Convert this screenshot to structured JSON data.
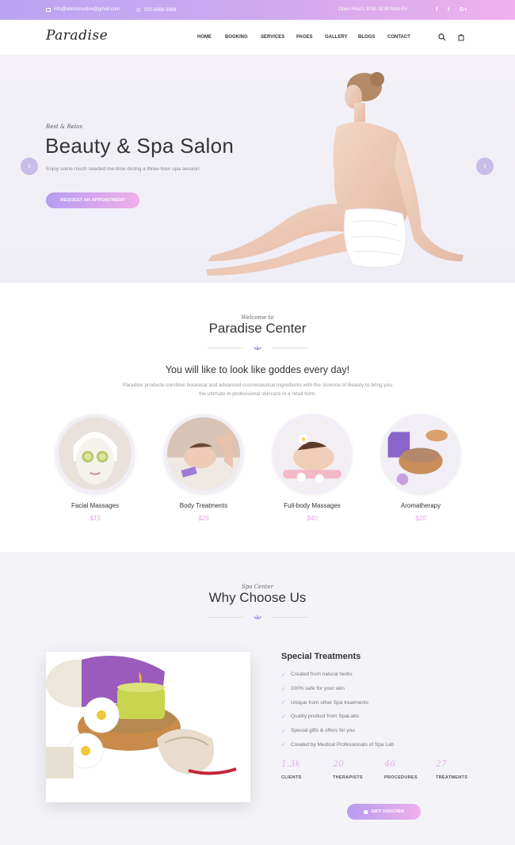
{
  "topbar": {
    "email": "info@elemcreative@gmail.com",
    "phone": "020-8888-8888",
    "hours": "Open Hours: 8:00-18:00 Mon-Fri",
    "social": [
      "f",
      "t",
      "G+"
    ]
  },
  "header": {
    "logo": "Paradise",
    "nav": [
      "HOME",
      "BOOKING",
      "SERVICES",
      "PAGES",
      "GALLERY",
      "BLOGS",
      "CONTACT"
    ]
  },
  "hero": {
    "script": "Rest & Relax",
    "title": "Beauty & Spa Salon",
    "subtitle": "Enjoy some much needed me-time during a three-hour spa session.",
    "button": "REQUEST AN APPOINTMENT",
    "prev_icon": "chevron-left-icon",
    "next_icon": "chevron-right-icon"
  },
  "welcome": {
    "script": "Welcome to",
    "title": "Paradise Center",
    "tagline": "You will like to look like goddes every day!",
    "paragraph": "Paradise products combine botanical and advanced cosmeceutical ingredients with the Science of Beauty to bring you the ultimate in professional skincare in a retail form."
  },
  "services": [
    {
      "label": "Facial Massages",
      "price": "$15"
    },
    {
      "label": "Body Treatments",
      "price": "$25"
    },
    {
      "label": "Full-body Massages",
      "price": "$40"
    },
    {
      "label": "Aromatherapy",
      "price": "$20"
    }
  ],
  "why": {
    "script": "Spa Center",
    "title": "Why Choose Us",
    "treatments_title": "Special Treatments",
    "treatments": [
      "Created from natural herbs",
      "100% safe for your skin",
      "Unique from other Spa treatments",
      "Quality product from SpaLabs",
      "Special gifts & offers for you",
      "Created by Medical Professionals of Spa Lab"
    ],
    "stats": [
      {
        "num": "1.3k",
        "label": "CLIENTS"
      },
      {
        "num": "20",
        "label": "THERAPISTS"
      },
      {
        "num": "46",
        "label": "PROCEDURES"
      },
      {
        "num": "27",
        "label": "TREATMENTS"
      }
    ],
    "voucher": "GIFT VOUCHER"
  },
  "colors": {
    "accent_from": "#b79cf0",
    "accent_to": "#f0b0ea",
    "price": "#e8a3e3"
  }
}
